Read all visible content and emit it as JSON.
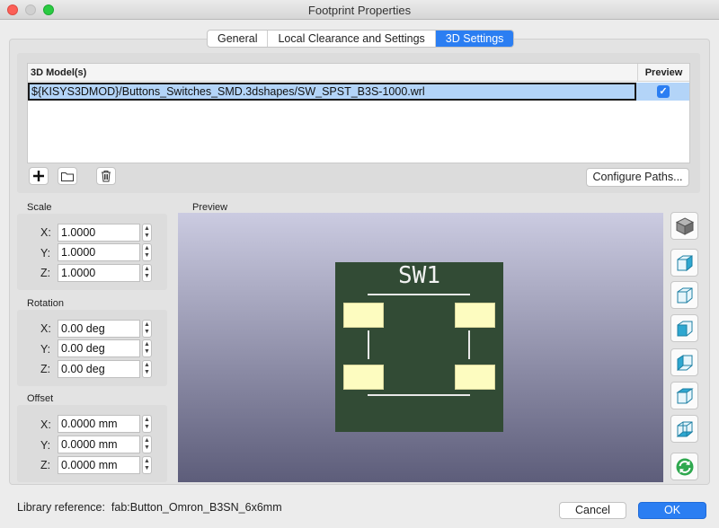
{
  "window": {
    "title": "Footprint Properties"
  },
  "tabs": [
    {
      "label": "General"
    },
    {
      "label": "Local Clearance and Settings"
    },
    {
      "label": "3D Settings"
    }
  ],
  "models_table": {
    "col_model": "3D Model(s)",
    "col_preview": "Preview",
    "rows": [
      {
        "path": "${KISYS3DMOD}/Buttons_Switches_SMD.3dshapes/SW_SPST_B3S-1000.wrl",
        "preview_checked": true
      }
    ]
  },
  "table_buttons": {
    "add_icon": "plus-icon",
    "browse_icon": "folder-icon",
    "delete_icon": "trash-icon",
    "configure_label": "Configure Paths..."
  },
  "scale": {
    "label": "Scale",
    "x_label": "X:",
    "x": "1.0000",
    "y_label": "Y:",
    "y": "1.0000",
    "z_label": "Z:",
    "z": "1.0000"
  },
  "rotation": {
    "label": "Rotation",
    "x_label": "X:",
    "x": "0.00 deg",
    "y_label": "Y:",
    "y": "0.00 deg",
    "z_label": "Z:",
    "z": "0.00 deg"
  },
  "offset": {
    "label": "Offset",
    "x_label": "X:",
    "x": "0.0000 mm",
    "y_label": "Y:",
    "y": "0.0000 mm",
    "z_label": "Z:",
    "z": "0.0000 mm"
  },
  "preview": {
    "label": "Preview",
    "silkscreen_text": "SW1",
    "board_color": "#324b35",
    "pad_color": "#fdfcc0"
  },
  "view_buttons": [
    "view-3d-icon",
    "view-right-icon",
    "view-front-icon",
    "view-top-icon",
    "view-left-icon",
    "view-back-icon",
    "view-bottom-icon",
    "reload-icon"
  ],
  "footer": {
    "library_reference_label": "Library reference:",
    "library_reference_value": "fab:Button_Omron_B3SN_6x6mm",
    "cancel_label": "Cancel",
    "ok_label": "OK"
  },
  "colors": {
    "accent": "#2b7ef2",
    "selection": "#b3d4f8"
  }
}
